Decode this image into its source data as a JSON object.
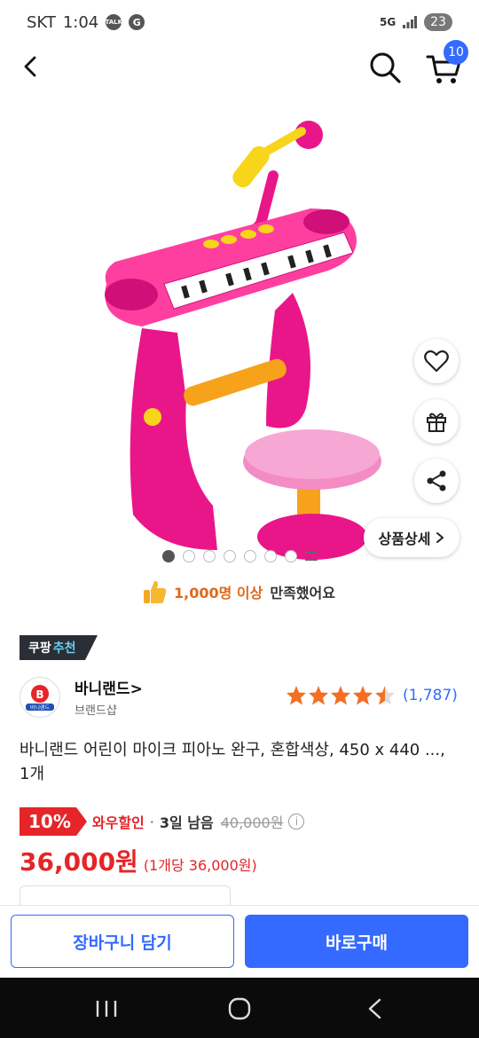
{
  "status_bar": {
    "carrier": "SKT",
    "time": "1:04",
    "talk_badge": "TALK",
    "g_badge": "G",
    "network": "5G",
    "battery": "23"
  },
  "header": {
    "cart_count": "10",
    "icons": [
      "back-icon",
      "search-icon",
      "cart-icon"
    ]
  },
  "gallery": {
    "slide_count": 7,
    "active_index": 0,
    "detail_button_label": "상품상세",
    "side_icons": [
      "heart-icon",
      "gift-icon",
      "share-icon"
    ]
  },
  "satisfaction": {
    "highlight": "1,000명 이상",
    "text": "만족했어요"
  },
  "recommend_badge": {
    "text1": "쿠팡",
    "text2": "추천"
  },
  "brand": {
    "name": "바니랜드",
    "subtitle": "브랜드샵",
    "logo_text": "바니랜드"
  },
  "rating": {
    "stars": 4.5,
    "review_count": "(1,787)"
  },
  "product": {
    "title": "바니랜드 어린이 마이크 피아노 완구, 혼합색상, 450 x 440 ..., 1개"
  },
  "pricing": {
    "discount_percent": "10%",
    "discount_label": "와우할인",
    "separator": "·",
    "days_left": "3일 남음",
    "original_price": "40,000원",
    "price": "36,000원",
    "unit_price": "(1개당 36,000원)"
  },
  "actions": {
    "add_to_cart": "장바구니 담기",
    "buy_now": "바로구매"
  },
  "colors": {
    "accent_blue": "#346aff",
    "discount_red": "#e52528",
    "star_orange": "#f36f24"
  }
}
